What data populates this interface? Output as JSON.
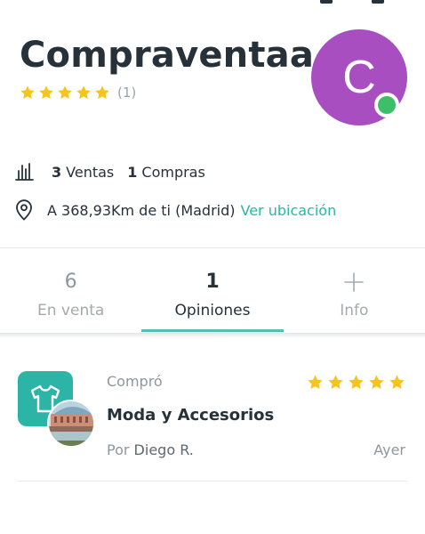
{
  "profile": {
    "name": "Compraventaa",
    "rating_stars": 5,
    "review_count": "(1)",
    "avatar_letter": "C",
    "online": true
  },
  "stats": {
    "sales_count": "3",
    "sales_label": "Ventas",
    "purchases_count": "1",
    "purchases_label": "Compras"
  },
  "location": {
    "text": "A 368,93Km de ti (Madrid)",
    "link_label": "Ver ubicación"
  },
  "tabs": [
    {
      "count": "6",
      "label": "En venta",
      "active": false
    },
    {
      "count": "1",
      "label": "Opiniones",
      "active": true
    },
    {
      "count": "",
      "icon": "plus-icon",
      "label": "Info",
      "active": false
    }
  ],
  "review": {
    "action": "Compró",
    "title": "Moda y Accesorios",
    "author_prefix": "Por",
    "author": "Diego R.",
    "time": "Ayer",
    "stars": 5,
    "category_icon": "tshirt-icon"
  },
  "colors": {
    "accent": "#2cb5a6",
    "star": "#f7c41d",
    "avatar_bg": "#a84ec0",
    "online": "#3bc069",
    "text": "#26313a",
    "muted": "#8e979e"
  }
}
